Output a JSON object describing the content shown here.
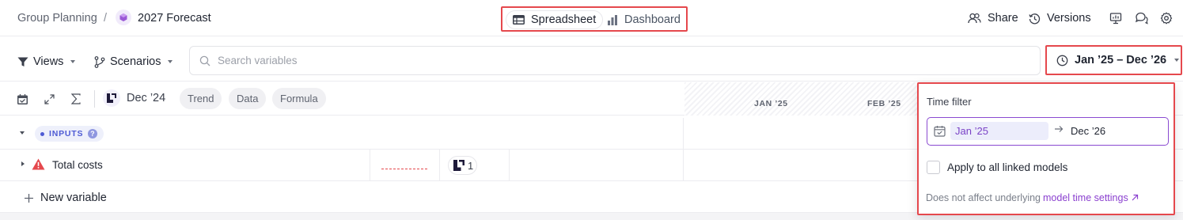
{
  "breadcrumb": {
    "parent": "Group Planning",
    "separator": "/",
    "current": "2027 Forecast"
  },
  "view_toggle": {
    "spreadsheet": "Spreadsheet",
    "dashboard": "Dashboard",
    "active": "Spreadsheet"
  },
  "header_actions": {
    "share": "Share",
    "versions": "Versions"
  },
  "toolbar": {
    "views": "Views",
    "scenarios": "Scenarios",
    "search_placeholder": "Search variables",
    "time_range": "Jan ’25 – Dec ’26"
  },
  "grid_toolbar": {
    "snapshot": "Dec ’24",
    "chips": [
      "Trend",
      "Data",
      "Formula"
    ],
    "months": [
      "JAN ’25",
      "FEB ’25"
    ]
  },
  "rows": {
    "group_label": "INPUTS",
    "group_help": "?",
    "variable_name": "Total costs",
    "reference_count": "1",
    "new_variable": "New variable"
  },
  "time_filter": {
    "title": "Time filter",
    "from": "Jan ’25",
    "to": "Dec ’26",
    "apply_all_label": "Apply to all linked models",
    "apply_all_checked": false,
    "note_prefix": "Does not affect underlying",
    "note_link": "model time settings"
  },
  "colors": {
    "accent": "#8a4ad1",
    "highlight_border": "#e5484d",
    "inputs_blue": "#4e5bd4",
    "warning": "#e5484d"
  }
}
